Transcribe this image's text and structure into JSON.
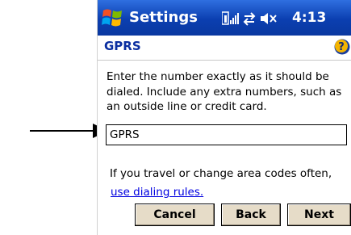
{
  "titlebar": {
    "app_title": "Settings",
    "time": "4:13",
    "status_icons": [
      "signal-icon",
      "connectivity-icon",
      "speaker-muted-icon"
    ]
  },
  "header": {
    "page_title": "GPRS",
    "help_icon": "help-icon"
  },
  "form": {
    "instructions": "Enter the number exactly as it should be dialed.  Include any extra numbers, such as an outside line or credit card.",
    "number_value": "GPRS",
    "travel_text": "If you travel or change area codes often,",
    "dialing_link": "use dialing rules."
  },
  "buttons": {
    "cancel": "Cancel",
    "back": "Back",
    "next": "Next"
  },
  "colors": {
    "titlebar": "#0b3fb0",
    "page_title": "#0a2ea0",
    "link": "#0000e0",
    "button_face": "#e6dcc8"
  }
}
